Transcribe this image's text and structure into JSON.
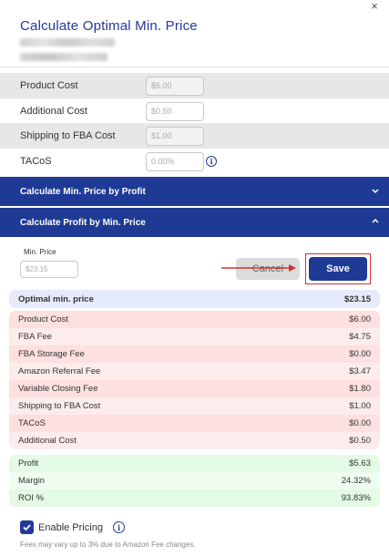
{
  "modal": {
    "title": "Calculate Optimal Min. Price",
    "close_glyph": "×"
  },
  "fields": [
    {
      "label": "Product Cost",
      "placeholder": "$6.00"
    },
    {
      "label": "Additional Cost",
      "placeholder": "$0.50"
    },
    {
      "label": "Shipping to FBA Cost",
      "placeholder": "$1.00"
    },
    {
      "label": "TACoS",
      "placeholder": "0.00%"
    }
  ],
  "sections": {
    "by_profit": "Calculate Min. Price by Profit",
    "by_min_price": "Calculate Profit by Min. Price"
  },
  "min_price": {
    "label": "Min. Price",
    "placeholder": "$23.15"
  },
  "buttons": {
    "cancel": "Cancel",
    "save": "Save"
  },
  "optimal": {
    "label": "Optimal min. price",
    "value": "$23.15"
  },
  "costs": [
    {
      "label": "Product Cost",
      "value": "$6.00"
    },
    {
      "label": "FBA Fee",
      "value": "$4.75"
    },
    {
      "label": "FBA Storage Fee",
      "value": "$0.00"
    },
    {
      "label": "Amazon Referral Fee",
      "value": "$3.47"
    },
    {
      "label": "Variable Closing Fee",
      "value": "$1.80"
    },
    {
      "label": "Shipping to FBA Cost",
      "value": "$1.00"
    },
    {
      "label": "TACoS",
      "value": "$0.00"
    },
    {
      "label": "Additional Cost",
      "value": "$0.50"
    }
  ],
  "profit": [
    {
      "label": "Profit",
      "value": "$5.63"
    },
    {
      "label": "Margin",
      "value": "24.32%"
    },
    {
      "label": "ROI %",
      "value": "93.83%"
    }
  ],
  "enable_pricing": {
    "label": "Enable Pricing",
    "checked": true
  },
  "footnote": "Fees may vary up to 3% due to Amazon Fee changes.",
  "colors": {
    "primary": "#1e3a94",
    "highlight": "#d23232",
    "cost_bg": "#fde0e0",
    "profit_bg": "#e3fae4",
    "optimal_bg": "#e6ebfb"
  },
  "icons": {
    "close": "close-icon",
    "info": "info-icon",
    "chevron_down": "chevron-down-icon",
    "chevron_up": "chevron-up-icon",
    "check": "check-icon",
    "arrow": "arrow-right-icon"
  }
}
